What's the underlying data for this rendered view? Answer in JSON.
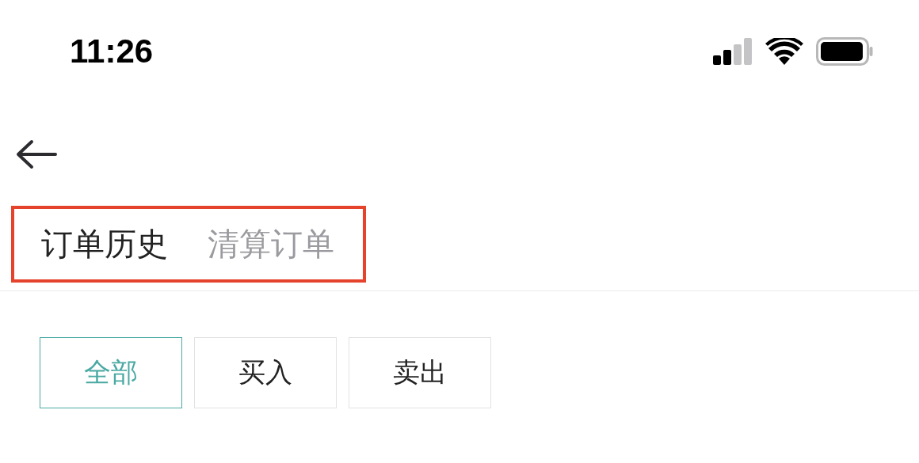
{
  "status_bar": {
    "time": "11:26"
  },
  "tabs": [
    {
      "label": "订单历史",
      "selected": true
    },
    {
      "label": "清算订单",
      "selected": false
    }
  ],
  "filters": [
    {
      "label": "全部",
      "selected": true
    },
    {
      "label": "买入",
      "selected": false
    },
    {
      "label": "卖出",
      "selected": false
    }
  ]
}
